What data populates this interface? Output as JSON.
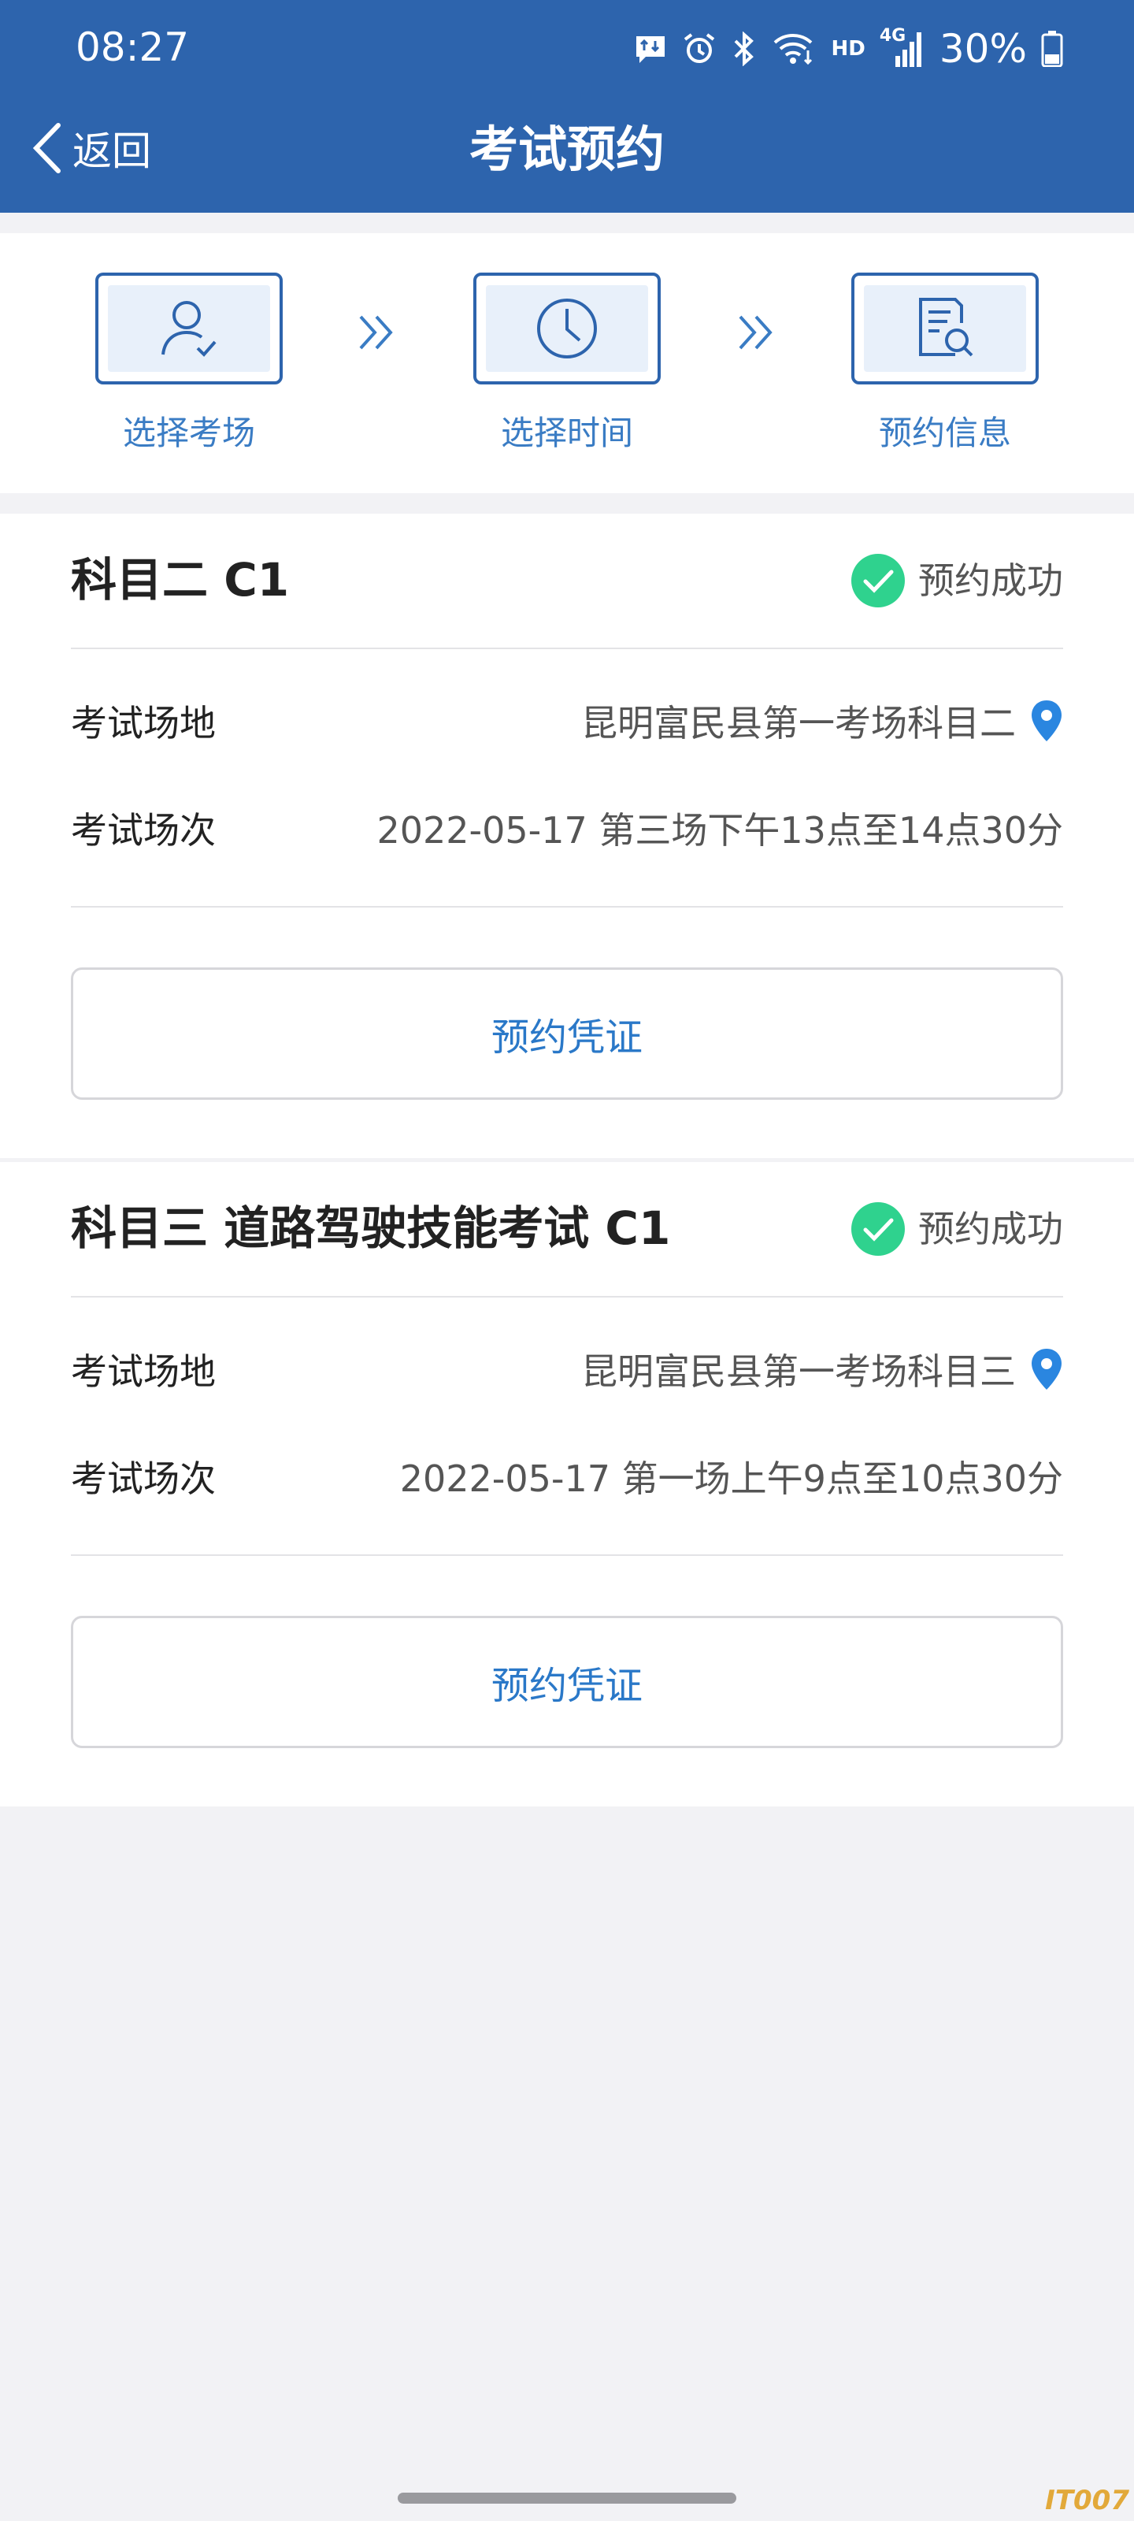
{
  "status_bar": {
    "time": "08:27",
    "battery": "30%",
    "network": "HD",
    "signal_gen": "4G",
    "icons": [
      "message-icon",
      "alarm-icon",
      "bluetooth-icon",
      "wifi-icon",
      "signal-icon",
      "battery-icon"
    ]
  },
  "nav": {
    "back_label": "返回",
    "title": "考试预约"
  },
  "steps": [
    {
      "label": "选择考场",
      "icon": "person-check-icon"
    },
    {
      "label": "选择时间",
      "icon": "clock-icon"
    },
    {
      "label": "预约信息",
      "icon": "document-search-icon"
    }
  ],
  "bookings": [
    {
      "title": "科目二 C1",
      "status": "预约成功",
      "venue_label": "考试场地",
      "venue": "昆明富民县第一考场科目二",
      "session_label": "考试场次",
      "session": "2022-05-17 第三场下午13点至14点30分",
      "button": "预约凭证"
    },
    {
      "title": "科目三 道路驾驶技能考试 C1",
      "status": "预约成功",
      "venue_label": "考试场地",
      "venue": "昆明富民县第一考场科目三",
      "session_label": "考试场次",
      "session": "2022-05-17 第一场上午9点至10点30分",
      "button": "预约凭证"
    }
  ],
  "watermark": "IT007",
  "colors": {
    "primary": "#2d64ad",
    "link": "#2a78c8",
    "success": "#2fd28e",
    "pin": "#2a86e0"
  }
}
